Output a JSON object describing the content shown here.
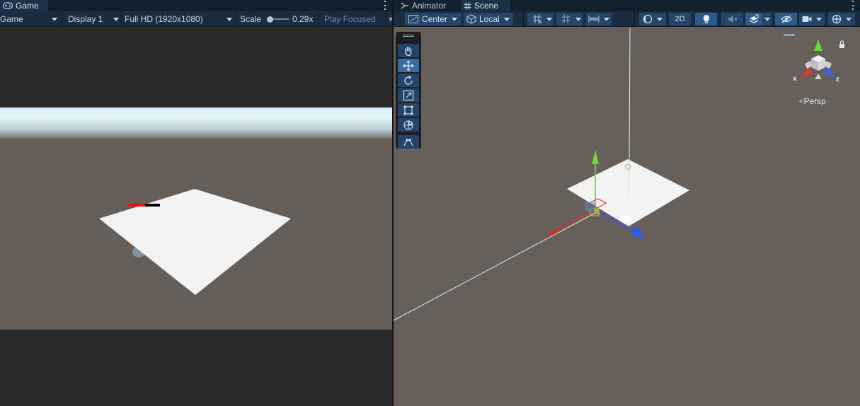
{
  "game": {
    "tab_label": "Game",
    "toolbar": {
      "view_mode": "Game",
      "display": "Display 1",
      "resolution": "Full HD (1920x1080)",
      "scale_label": "Scale",
      "scale_value": "0.29x",
      "play_mode": "Play Focused"
    }
  },
  "scene": {
    "tabs": [
      {
        "label": "Animator",
        "icon": "animator-icon"
      },
      {
        "label": "Scene",
        "icon": "grid-icon"
      }
    ],
    "toolbar": {
      "pivot": "Center",
      "space": "Local",
      "mode_2d": "2D"
    },
    "tools": [
      "hand-tool",
      "move-tool",
      "rotate-tool",
      "scale-tool",
      "rect-tool",
      "transform-tool",
      "custom-tool"
    ],
    "active_tool": "move-tool",
    "orientation": {
      "projection": "Persp",
      "x": "x",
      "z": "z"
    }
  },
  "colors": {
    "accent": "#2d5a88",
    "x_axis": "#e8302c",
    "y_axis": "#6ad835",
    "z_axis": "#2f5cf0"
  }
}
